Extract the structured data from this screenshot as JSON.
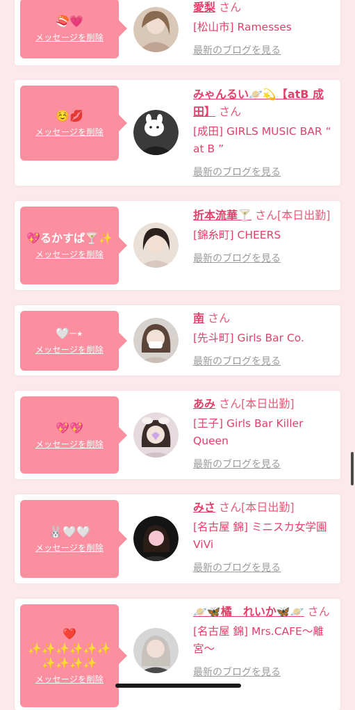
{
  "messages": [
    {
      "stamp": "🍣💗",
      "delete_label": "メッセージを削除",
      "name": "愛梨",
      "suffix": " さん",
      "shop": "[松山市] Ramesses",
      "blog_label": "最新のブログを見る",
      "avatar": "woman-photo-icon"
    },
    {
      "stamp": "☺️💋",
      "delete_label": "メッセージを削除",
      "name": "みゃんるい🪐💫【atB 成田】",
      "suffix": " さん",
      "shop": "[成田] GIRLS MUSIC BAR “ at B ”",
      "blog_label": "最新のブログを見る",
      "avatar": "woman-photo-icon"
    },
    {
      "stamp": "💖るかすぱ🍸✨",
      "delete_label": "メッセージを削除",
      "name": "折本流華🍸",
      "suffix": " さん[本日出勤]",
      "shop": "[錦糸町] CHEERS",
      "blog_label": "最新のブログを見る",
      "avatar": "woman-photo-icon"
    },
    {
      "stamp": "🤍┈⋆",
      "delete_label": "メッセージを削除",
      "name": "南",
      "suffix": " さん",
      "shop": "[先斗町] Girls Bar Co.",
      "blog_label": "最新のブログを見る",
      "avatar": "woman-photo-icon"
    },
    {
      "stamp": "💖💖",
      "delete_label": "メッセージを削除",
      "name": "あみ",
      "suffix": " さん[本日出勤]",
      "shop": "[王子] Girls Bar Killer Queen",
      "blog_label": "最新のブログを見る",
      "avatar": "woman-photo-icon"
    },
    {
      "stamp": "🐰🤍🤍",
      "delete_label": "メッセージを削除",
      "name": "みさ",
      "suffix": " さん[本日出勤]",
      "shop": "[名古屋 錦] ミニスカ女学園ViVi",
      "blog_label": "最新のブログを見る",
      "avatar": "woman-photo-icon"
    },
    {
      "stamp": "❤️\n✨✨✨✨✨✨\n✨✨✨✨",
      "delete_label": "メッセージを削除",
      "name": "🪐🦋橘　れいか🦋🪐",
      "suffix": " さん",
      "shop": "[名古屋 錦] Mrs.CAFE〜離宮〜",
      "blog_label": "最新のブログを見る",
      "avatar": "woman-photo-icon"
    }
  ],
  "colors": {
    "accent": "#fb8fa0",
    "name": "#e0416a",
    "background": "#fbe9ec",
    "link_gray": "#9a9a9a"
  }
}
